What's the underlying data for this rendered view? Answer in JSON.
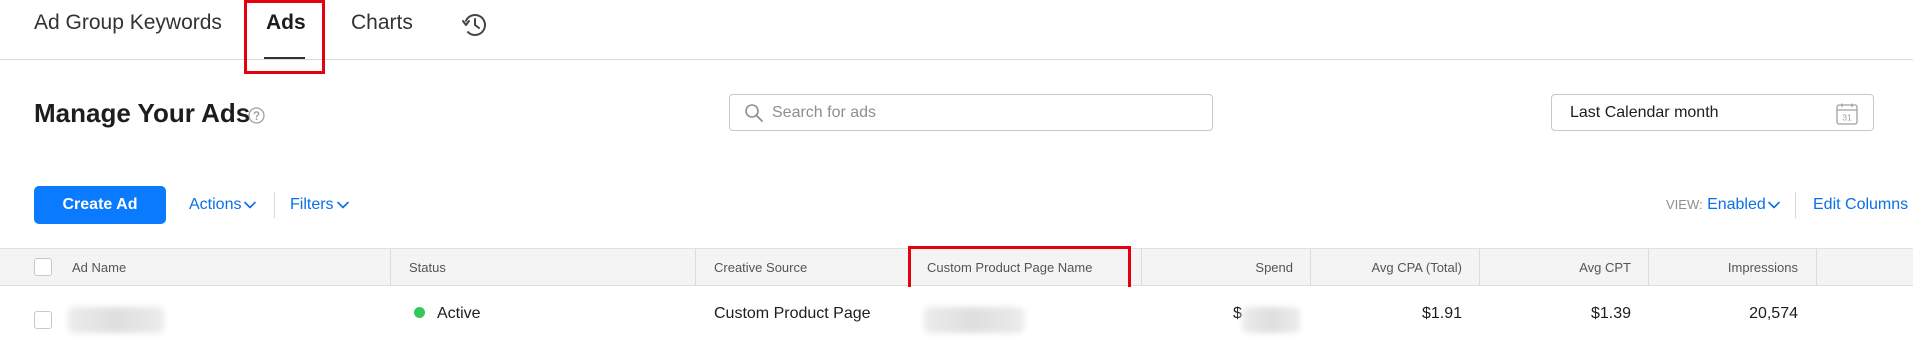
{
  "tabs": [
    {
      "label": "Ad Group Keywords"
    },
    {
      "label": "Ads",
      "active": true
    },
    {
      "label": "Charts"
    },
    {
      "icon": "history-icon"
    }
  ],
  "header": {
    "title": "Manage Your Ads",
    "help_icon": "help-circle-icon",
    "search": {
      "placeholder": "Search for ads",
      "value": "",
      "icon": "search-icon"
    },
    "date_range": {
      "label": "Last Calendar month",
      "icon": "calendar-icon",
      "calendar_day": "31"
    }
  },
  "toolbar": {
    "create_label": "Create Ad",
    "actions_label": "Actions",
    "filters_label": "Filters",
    "view_label": "VIEW:",
    "view_value": "Enabled",
    "edit_columns_label": "Edit Columns"
  },
  "table": {
    "columns": [
      "Ad Name",
      "Status",
      "Creative Source",
      "Custom Product Page Name",
      "Spend",
      "Avg CPA (Total)",
      "Avg CPT",
      "Impressions"
    ],
    "rows": [
      {
        "ad_name": "",
        "status": "Active",
        "creative_source": "Custom Product Page",
        "custom_product_page_name": "",
        "spend_prefix": "$",
        "avg_cpa": "$1.91",
        "avg_cpt": "$1.39",
        "impressions": "20,574"
      }
    ]
  },
  "colors": {
    "accent": "#0a7aff",
    "link": "#0a70e6",
    "status_active": "#34c759",
    "highlight": "#e3000f"
  }
}
